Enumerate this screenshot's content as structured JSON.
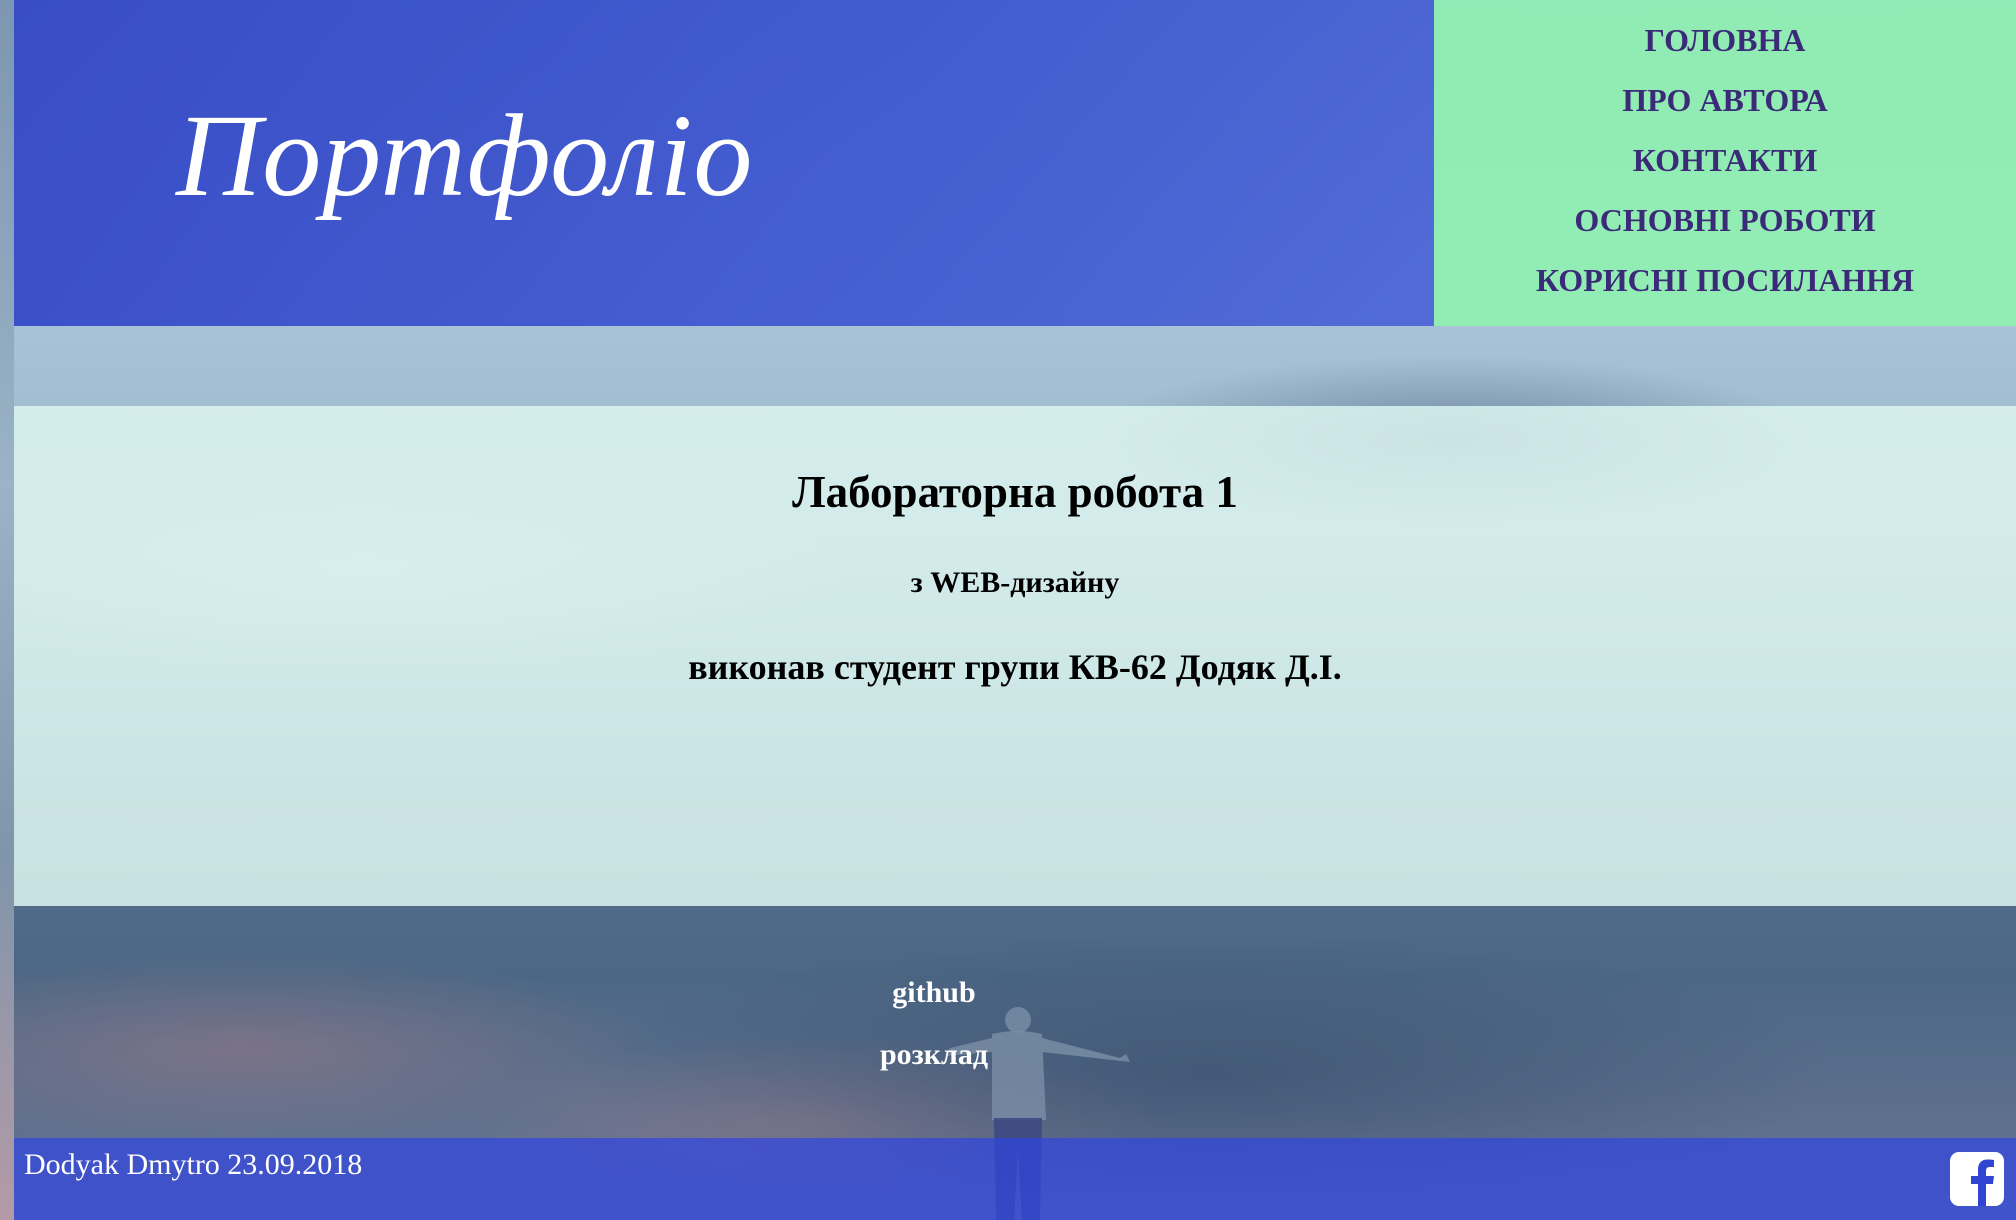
{
  "header": {
    "title": "Портфоліо"
  },
  "nav": {
    "items": [
      {
        "label": "ГОЛОВНА"
      },
      {
        "label": "ПРО АВТОРА"
      },
      {
        "label": "КОНТАКТИ"
      },
      {
        "label": "ОСНОВНІ РОБОТИ"
      },
      {
        "label": "КОРИСНІ ПОСИЛАННЯ"
      }
    ]
  },
  "main": {
    "heading": "Лабораторна робота 1",
    "subheading": "з WEB-дизайну",
    "author_line": "виконав студент групи КВ-62 Додяк Д.І."
  },
  "links": {
    "github": "github",
    "schedule": "розклад"
  },
  "footer": {
    "text": "Dodyak Dmytro 23.09.2018",
    "social_icon": "facebook-icon"
  },
  "colors": {
    "header_bg": "#3448c8",
    "nav_bg": "#92eeb4",
    "nav_text": "#3a2a78",
    "main_bg": "#def6f2",
    "footer_bg": "#3046d2"
  }
}
